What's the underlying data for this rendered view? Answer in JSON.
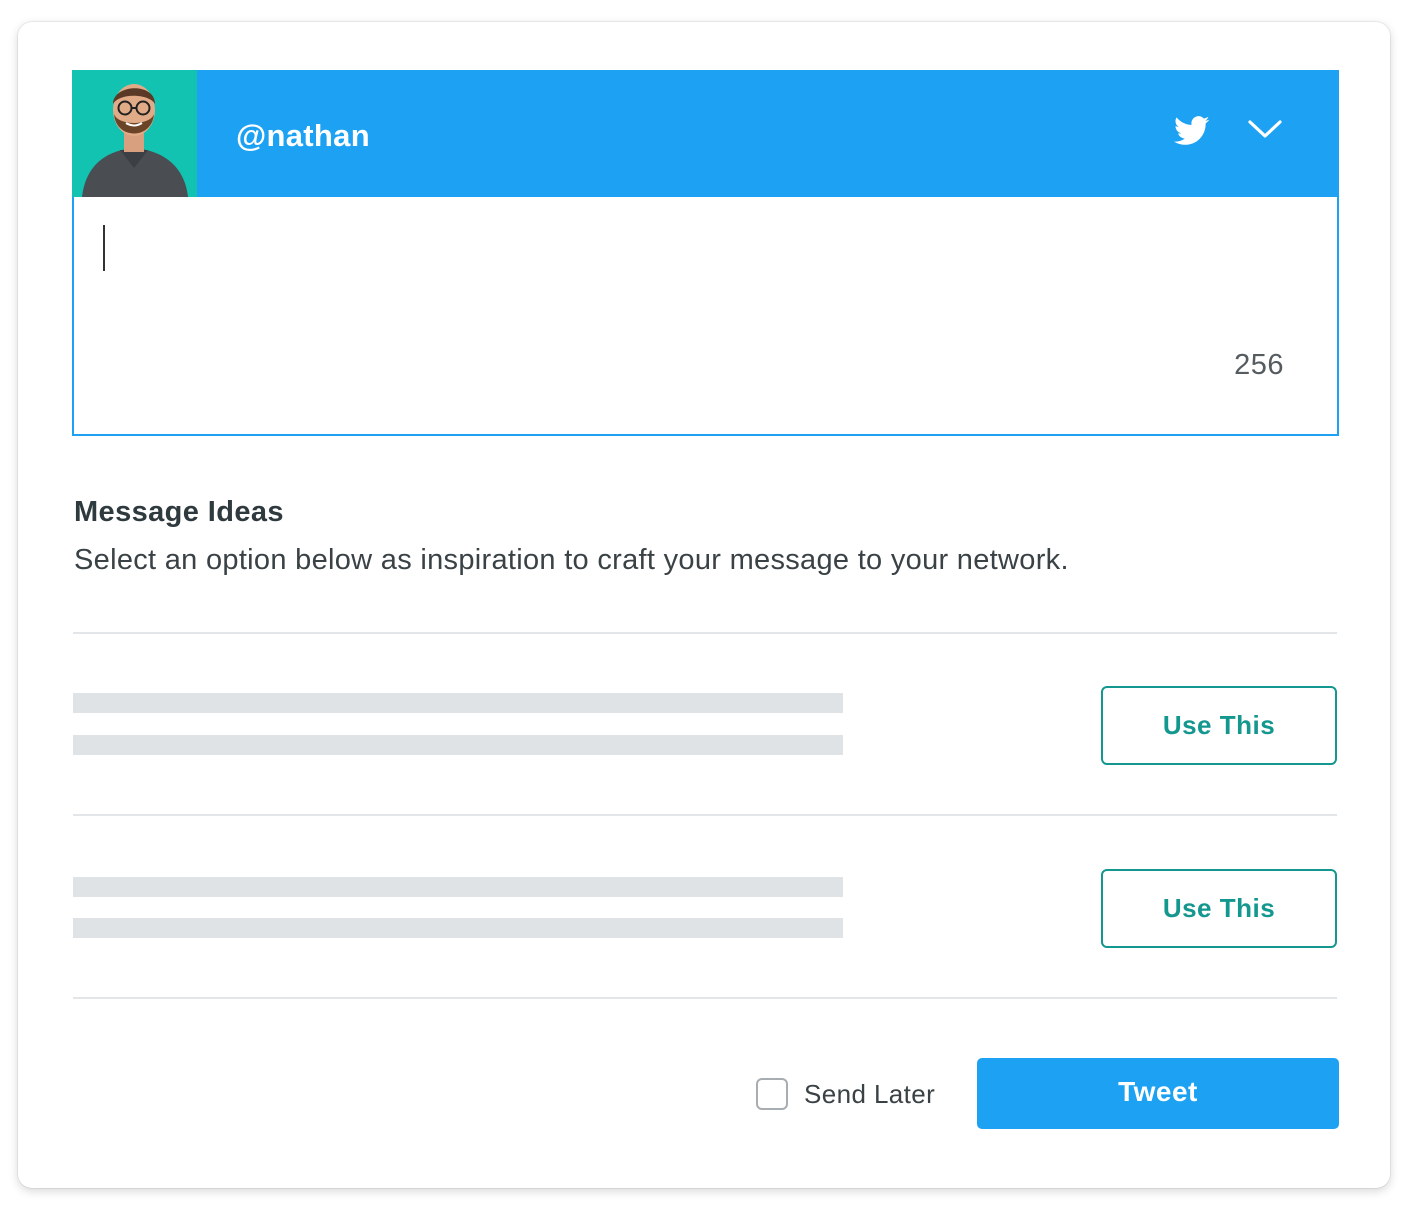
{
  "account": {
    "handle": "@nathan",
    "network_icon": "twitter-icon",
    "dropdown_icon": "chevron-down-icon",
    "brand_color": "#1da1f2",
    "avatar_background": "#12c3b2"
  },
  "compose": {
    "value": "",
    "char_count": "256"
  },
  "ideas": {
    "title": "Message Ideas",
    "description": "Select an option below as inspiration to craft your message to your network.",
    "items": [
      {
        "button_label": "Use This"
      },
      {
        "button_label": "Use This"
      }
    ],
    "accent_color": "#13978f"
  },
  "footer": {
    "send_later_label": "Send Later",
    "send_later_checked": false,
    "tweet_label": "Tweet"
  }
}
